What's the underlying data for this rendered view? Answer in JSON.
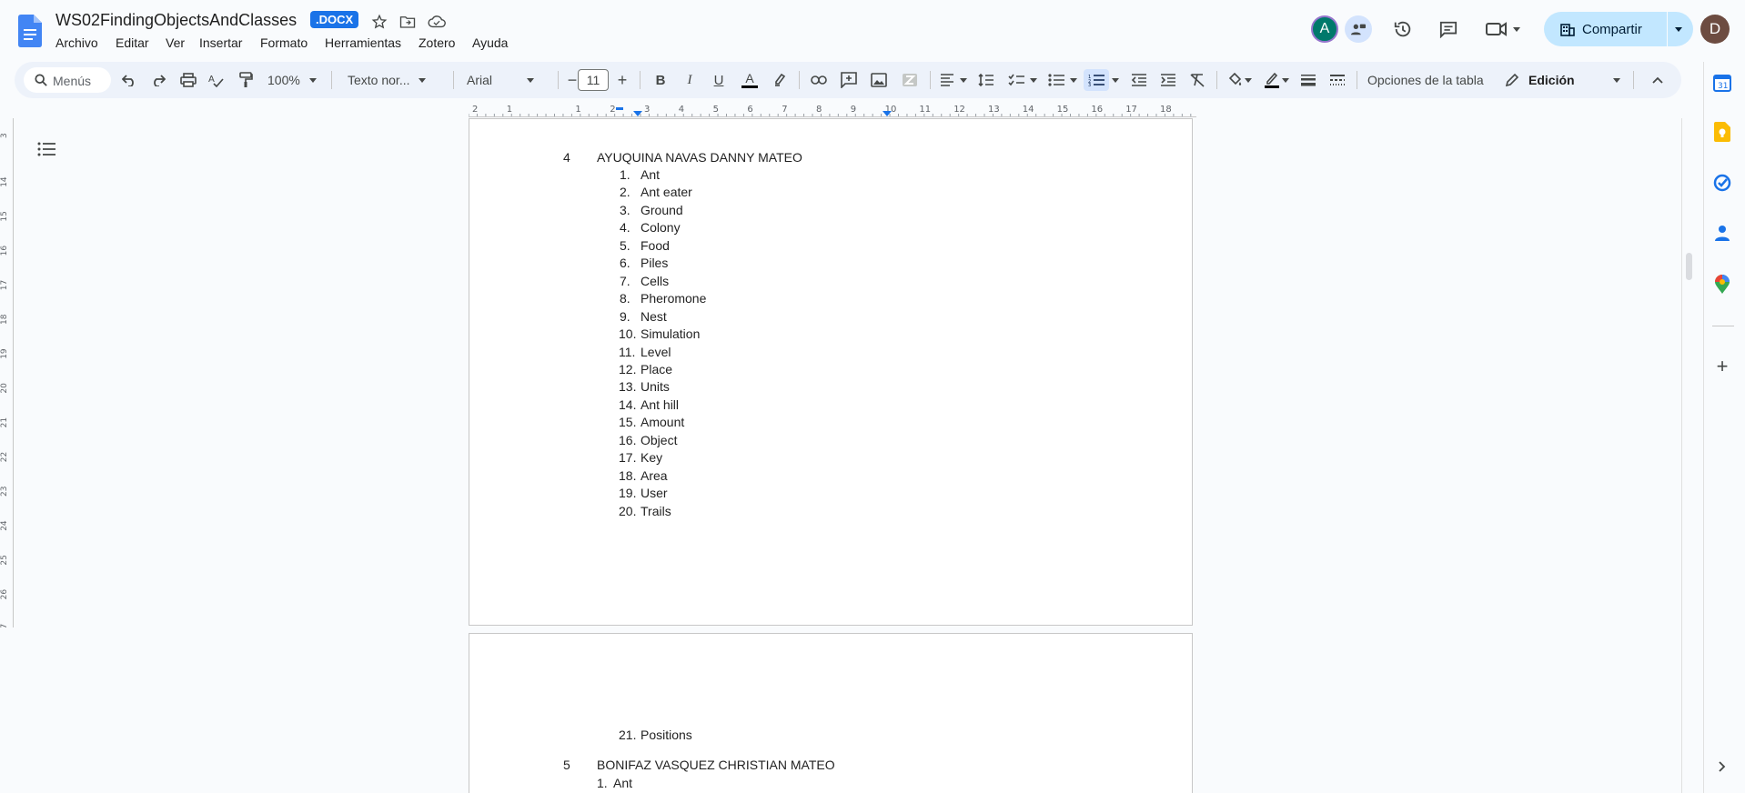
{
  "header": {
    "title": "WS02FindingObjectsAndClasses",
    "badge": ".DOCX",
    "menus": [
      "Archivo",
      "Editar",
      "Ver",
      "Insertar",
      "Formato",
      "Herramientas",
      "Zotero",
      "Ayuda"
    ],
    "share_label": "Compartir",
    "avatar_a": "A",
    "avatar_d": "D"
  },
  "toolbar": {
    "search_placeholder": "Menús",
    "zoom": "100%",
    "style": "Texto nor...",
    "font": "Arial",
    "font_size": "11",
    "table_options": "Opciones de la tabla",
    "mode": "Edición"
  },
  "ruler": {
    "top_ticks": [
      "2",
      "1",
      "1",
      "2",
      "3",
      "4",
      "5",
      "6",
      "7",
      "8",
      "9",
      "10",
      "11",
      "12",
      "13",
      "14",
      "15",
      "16",
      "17",
      "18"
    ],
    "left_ticks": [
      "3",
      "14",
      "15",
      "16",
      "17",
      "18",
      "19",
      "20",
      "21",
      "22",
      "23",
      "24",
      "25",
      "26",
      "27"
    ]
  },
  "document": {
    "entry1": {
      "num": "4",
      "name": "AYUQUINA NAVAS DANNY MATEO"
    },
    "list1": [
      {
        "n": "1.",
        "t": "Ant"
      },
      {
        "n": "2.",
        "t": "Ant eater"
      },
      {
        "n": "3.",
        "t": "Ground"
      },
      {
        "n": "4.",
        "t": "Colony"
      },
      {
        "n": "5.",
        "t": "Food"
      },
      {
        "n": "6.",
        "t": "Piles"
      },
      {
        "n": "7.",
        "t": "Cells"
      },
      {
        "n": "8.",
        "t": "Pheromone"
      },
      {
        "n": "9.",
        "t": "Nest"
      },
      {
        "n": "10.",
        "t": "Simulation"
      },
      {
        "n": "11.",
        "t": "Level"
      },
      {
        "n": "12.",
        "t": "Place"
      },
      {
        "n": "13.",
        "t": "Units"
      },
      {
        "n": "14.",
        "t": "Ant hill"
      },
      {
        "n": "15.",
        "t": "Amount"
      },
      {
        "n": "16.",
        "t": "Object"
      },
      {
        "n": "17.",
        "t": "Key"
      },
      {
        "n": "18.",
        "t": "Area"
      },
      {
        "n": "19.",
        "t": "User"
      },
      {
        "n": "20.",
        "t": "Trails"
      }
    ],
    "list1_continued": {
      "n": "21.",
      "t": "Positions"
    },
    "entry2": {
      "num": "5",
      "name": "BONIFAZ VASQUEZ CHRISTIAN MATEO"
    },
    "list2": [
      {
        "n": "1.",
        "t": "Ant"
      }
    ]
  },
  "colors": {
    "accent": "#1a73e8",
    "share_bg": "#c2e7ff",
    "avatar_a": "#00796b",
    "avatar_d": "#6d4c41"
  }
}
